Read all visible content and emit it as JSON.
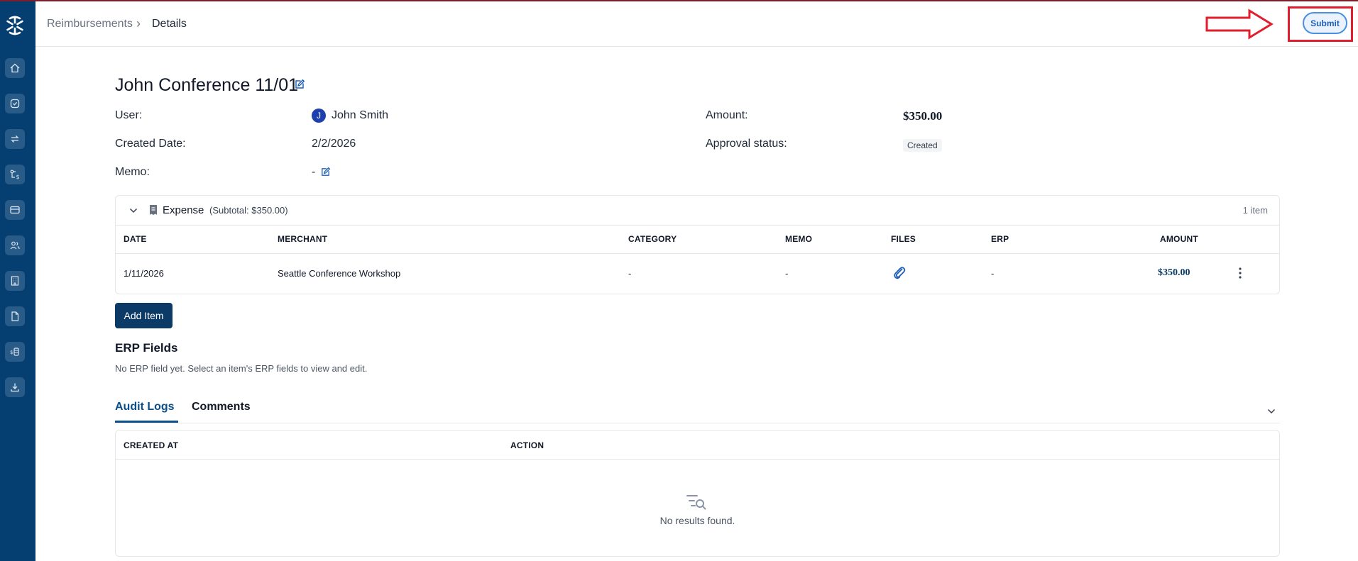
{
  "breadcrumb": {
    "root": "Reimbursements",
    "separator": "›",
    "current": "Details"
  },
  "actions": {
    "submit_label": "Submit"
  },
  "report": {
    "title": "John Conference 11/01",
    "user_label": "User:",
    "user_initial": "J",
    "user_name": "John Smith",
    "created_label": "Created Date:",
    "created_value": "2/2/2026",
    "memo_label": "Memo:",
    "memo_value": "-",
    "amount_label": "Amount:",
    "amount_value": "$350.00",
    "status_label": "Approval status:",
    "status_value": "Created"
  },
  "expense": {
    "title": "Expense",
    "subtotal": "(Subtotal: $350.00)",
    "count": "1 item",
    "columns": [
      "DATE",
      "MERCHANT",
      "CATEGORY",
      "MEMO",
      "FILES",
      "ERP",
      "AMOUNT"
    ],
    "rows": [
      {
        "date": "1/11/2026",
        "merchant": "Seattle Conference Workshop",
        "category": "-",
        "memo": "-",
        "erp": "-",
        "amount": "$350.00"
      }
    ],
    "add_label": "Add Item"
  },
  "erp": {
    "title": "ERP Fields",
    "note": "No ERP field yet. Select an item's ERP fields to view and edit."
  },
  "tabs": [
    {
      "label": "Audit Logs",
      "active": true
    },
    {
      "label": "Comments",
      "active": false
    }
  ],
  "audit": {
    "columns": [
      "CREATED AT",
      "ACTION"
    ],
    "empty_text": "No results found."
  },
  "colors": {
    "sidebar": "#053f72",
    "primary": "#0b3a66",
    "highlight": "#e11d2e",
    "submit_border": "#4a90e2"
  },
  "icons": {
    "sidebar": [
      "home-icon",
      "check-circle-icon",
      "transfer-icon",
      "workflow-dollar-icon",
      "card-icon",
      "users-icon",
      "building-icon",
      "document-icon",
      "money-stack-icon",
      "download-icon"
    ]
  }
}
